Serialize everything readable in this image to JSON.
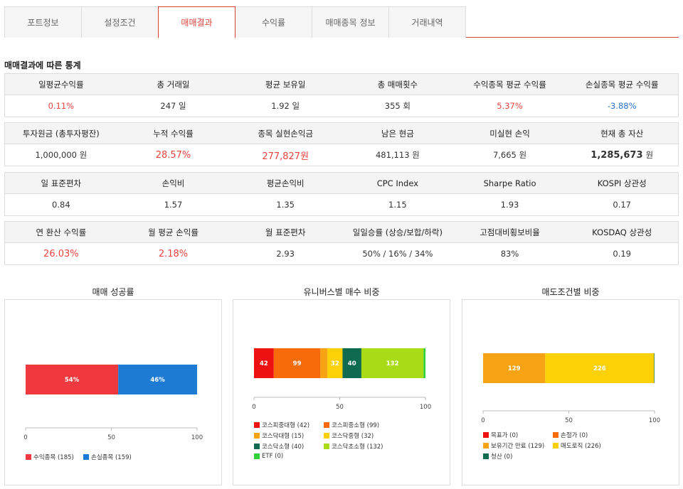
{
  "tabs": [
    {
      "label": "포트정보",
      "active": false
    },
    {
      "label": "설정조건",
      "active": false
    },
    {
      "label": "매매결과",
      "active": true
    },
    {
      "label": "수익률",
      "active": false
    },
    {
      "label": "매매종목 정보",
      "active": false
    },
    {
      "label": "거래내역",
      "active": false
    }
  ],
  "section_title": "매매결과에 따른 통계",
  "stats": {
    "row1": {
      "headers": [
        "일평균수익률",
        "총 거래일",
        "평균 보유일",
        "총 매매횟수",
        "수익종목 평균 수익률",
        "손실종목 평균 수익률"
      ],
      "values": [
        "0.11%",
        "247 일",
        "1.92 일",
        "355 회",
        "5.37%",
        "-3.88%"
      ]
    },
    "row2": {
      "headers": [
        "투자원금 (총투자평잔)",
        "누적 수익률",
        "종목 실현손익금",
        "남은 현금",
        "미실현 손익",
        "현재 총 자산"
      ],
      "values": [
        "1,000,000 원",
        "28.57%",
        "277,827원",
        "481,113 원",
        "7,665 원",
        "1,285,673"
      ],
      "total_unit": "원"
    },
    "row3": {
      "headers": [
        "일 표준편차",
        "손익비",
        "평균손익비",
        "CPC Index",
        "Sharpe Ratio",
        "KOSPI 상관성"
      ],
      "values": [
        "0.84",
        "1.57",
        "1.35",
        "1.15",
        "1.93",
        "0.17"
      ]
    },
    "row4": {
      "headers": [
        "연 환산 수익률",
        "월 평균 손익률",
        "월 표준편차",
        "일일승률 (상승/보합/하락)",
        "고점대비횡보비율",
        "KOSDAQ 상관성"
      ],
      "values": [
        "26.03%",
        "2.18%",
        "2.93",
        "50% / 16% / 34%",
        "83%",
        "0.19"
      ]
    }
  },
  "chart_data": [
    {
      "type": "bar",
      "title": "매매 성공률",
      "orientation": "horizontal-stacked-percent",
      "xlim": [
        0,
        100
      ],
      "ticks": [
        "0",
        "50",
        "100"
      ],
      "series": [
        {
          "name": "수익종목 (185)",
          "value": 54,
          "label": "54%",
          "color": "#f0393f"
        },
        {
          "name": "손실종목 (159)",
          "value": 46,
          "label": "46%",
          "color": "#1e7bd4"
        }
      ]
    },
    {
      "type": "bar",
      "title": "유니버스별 매수 비중",
      "orientation": "horizontal-stacked-percent",
      "xlim": [
        0,
        100
      ],
      "ticks": [
        "0",
        "50",
        "100"
      ],
      "series": [
        {
          "name": "코스피중대형 (42)",
          "value": 42,
          "label": "42",
          "color": "#ee1111"
        },
        {
          "name": "코스피중소형 (99)",
          "value": 99,
          "label": "99",
          "color": "#f76b0a"
        },
        {
          "name": "코스닥대형 (15)",
          "value": 15,
          "label": "",
          "color": "#f8a313"
        },
        {
          "name": "코스닥중형 (32)",
          "value": 32,
          "label": "32",
          "color": "#fcd106"
        },
        {
          "name": "코스닥소형 (40)",
          "value": 40,
          "label": "40",
          "color": "#0e6b50"
        },
        {
          "name": "코스닥초소형 (132)",
          "value": 132,
          "label": "132",
          "color": "#a9dc16"
        },
        {
          "name": "ETF (0)",
          "value": 4,
          "label": "",
          "color": "#2fd038"
        }
      ]
    },
    {
      "type": "bar",
      "title": "매도조건별 비중",
      "orientation": "horizontal-stacked-percent",
      "xlim": [
        0,
        100
      ],
      "ticks": [
        "0",
        "50",
        "100"
      ],
      "series": [
        {
          "name": "목표가 (0)",
          "value": 0,
          "label": "",
          "color": "#ee1111"
        },
        {
          "name": "손절가 (0)",
          "value": 0,
          "label": "",
          "color": "#f76b0a"
        },
        {
          "name": "보유기간 만료 (129)",
          "value": 129,
          "label": "129",
          "color": "#f8a313"
        },
        {
          "name": "매도로직 (226)",
          "value": 226,
          "label": "226",
          "color": "#fcd106"
        },
        {
          "name": "청산 (0)",
          "value": 1,
          "label": "",
          "color": "#0e6b50"
        }
      ]
    }
  ]
}
